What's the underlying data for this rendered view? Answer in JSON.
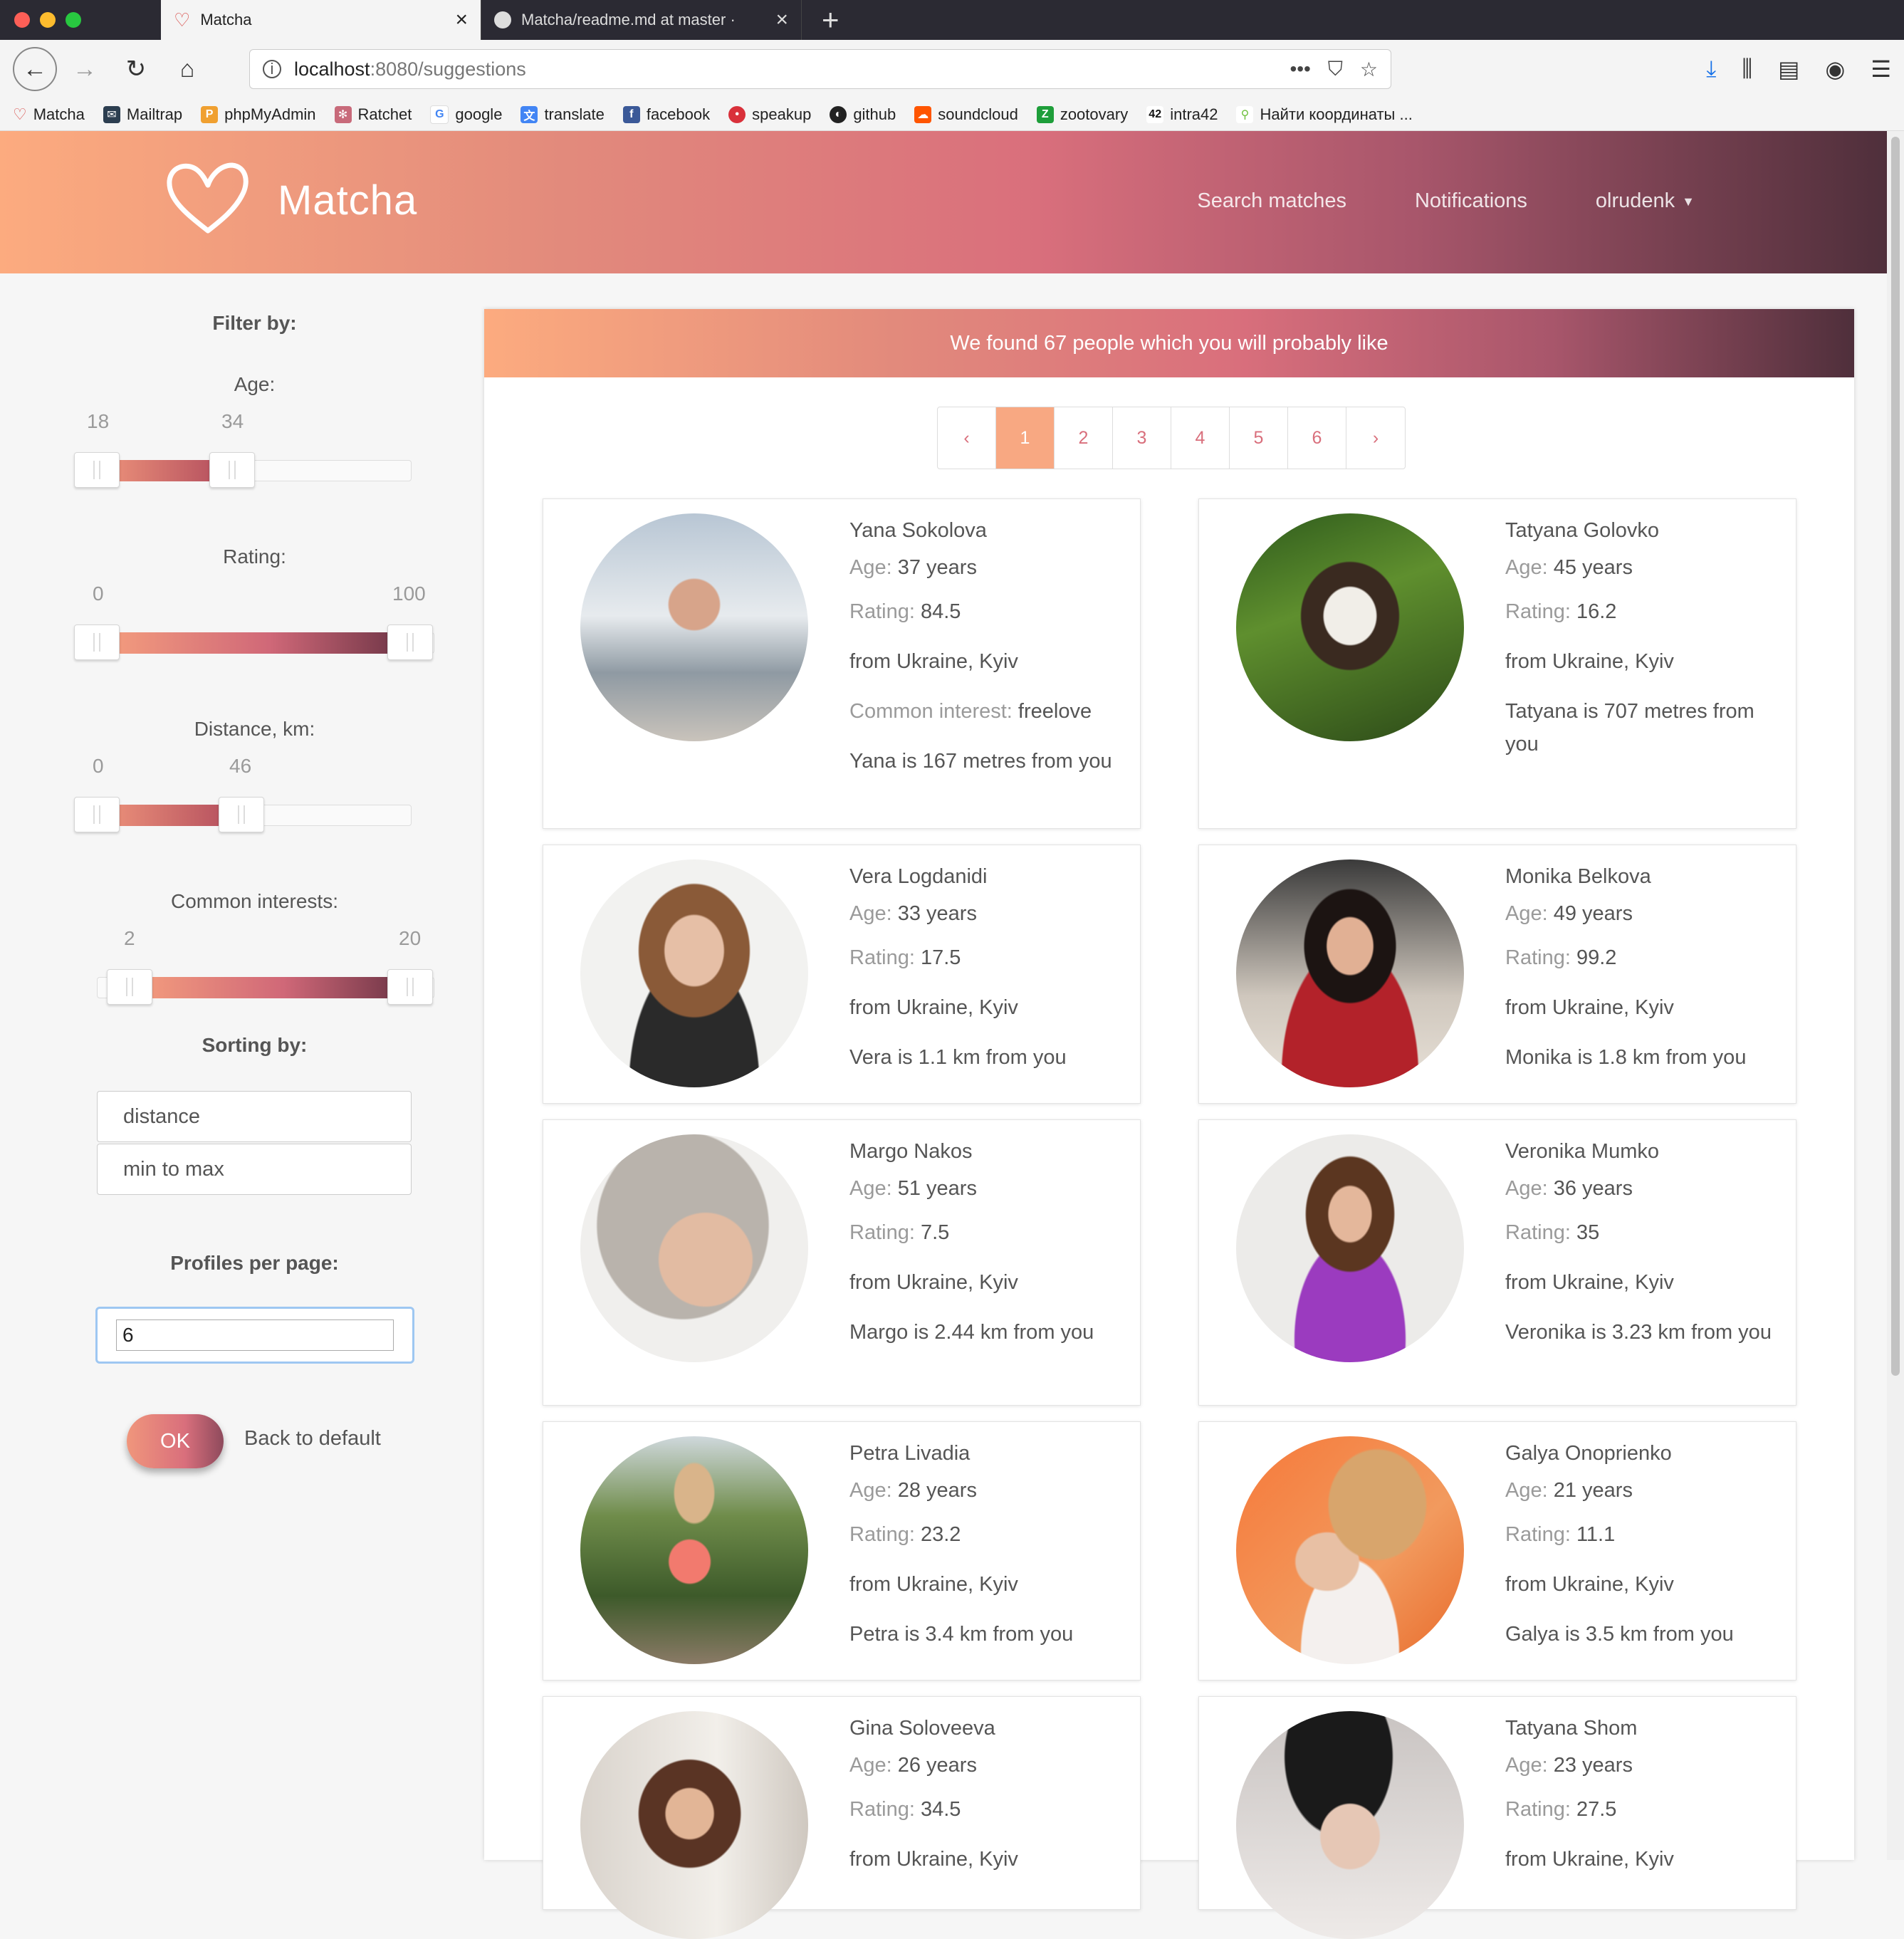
{
  "browser": {
    "tabs": [
      {
        "title": "Matcha",
        "icon": "heart-icon"
      },
      {
        "title": "Matcha/readme.md at master · ",
        "icon": "github-icon"
      }
    ],
    "url_host": "localhost",
    "url_path": ":8080/suggestions",
    "bookmarks": [
      "Matcha",
      "Mailtrap",
      "phpMyAdmin",
      "Ratchet",
      "google",
      "translate",
      "facebook",
      "speakup",
      "github",
      "soundcloud",
      "zootovary",
      "intra42",
      "Найти координаты ..."
    ]
  },
  "header": {
    "brand": "Matcha",
    "nav": [
      "Search matches",
      "Notifications",
      "olrudenk"
    ]
  },
  "filters": {
    "title": "Filter by:",
    "age": {
      "label": "Age:",
      "min": "18",
      "max": "34",
      "range_min": 18,
      "range_max": 60
    },
    "rating": {
      "label": "Rating:",
      "min": "0",
      "max": "100"
    },
    "distance": {
      "label": "Distance, km:",
      "min": "0",
      "max": "46"
    },
    "interests": {
      "label": "Common interests:",
      "min": "2",
      "max": "20"
    },
    "sorting_title": "Sorting by:",
    "sort_field": "distance",
    "sort_order": "min to max",
    "per_page_title": "Profiles per page:",
    "per_page": "6",
    "ok": "OK",
    "back": "Back to default"
  },
  "main": {
    "banner": "We found 67 people which you will probably like",
    "pages": [
      "‹",
      "1",
      "2",
      "3",
      "4",
      "5",
      "6",
      "›"
    ],
    "active_page": "1",
    "age_label": "Age:",
    "rating_label": "Rating:",
    "interest_label": "Common interest:",
    "profiles": [
      {
        "name": "Yana Sokolova",
        "age": "37 years",
        "rating": "84.5",
        "from": "from Ukraine, Kyiv",
        "interest": "freelove",
        "distance": "Yana is 167 metres from you"
      },
      {
        "name": "Tatyana Golovko",
        "age": "45 years",
        "rating": "16.2",
        "from": "from Ukraine, Kyiv",
        "distance": "Tatyana is 707 metres from you"
      },
      {
        "name": "Vera Logdanidi",
        "age": "33 years",
        "rating": "17.5",
        "from": "from Ukraine, Kyiv",
        "distance": "Vera is 1.1 km from you"
      },
      {
        "name": "Monika Belkova",
        "age": "49 years",
        "rating": "99.2",
        "from": "from Ukraine, Kyiv",
        "distance": "Monika is 1.8 km from you"
      },
      {
        "name": "Margo Nakos",
        "age": "51 years",
        "rating": "7.5",
        "from": "from Ukraine, Kyiv",
        "distance": "Margo is 2.44 km from you"
      },
      {
        "name": "Veronika Mumko",
        "age": "36 years",
        "rating": "35",
        "from": "from Ukraine, Kyiv",
        "distance": "Veronika is 3.23 km from you"
      },
      {
        "name": "Petra Livadia",
        "age": "28 years",
        "rating": "23.2",
        "from": "from Ukraine, Kyiv",
        "distance": "Petra is 3.4 km from you"
      },
      {
        "name": "Galya Onoprienko",
        "age": "21 years",
        "rating": "11.1",
        "from": "from Ukraine, Kyiv",
        "distance": "Galya is 3.5 km from you"
      },
      {
        "name": "Gina Soloveeva",
        "age": "26 years",
        "rating": "34.5",
        "from": "from Ukraine, Kyiv",
        "distance": ""
      },
      {
        "name": "Tatyana Shom",
        "age": "23 years",
        "rating": "27.5",
        "from": "from Ukraine, Kyiv",
        "distance": ""
      }
    ]
  }
}
